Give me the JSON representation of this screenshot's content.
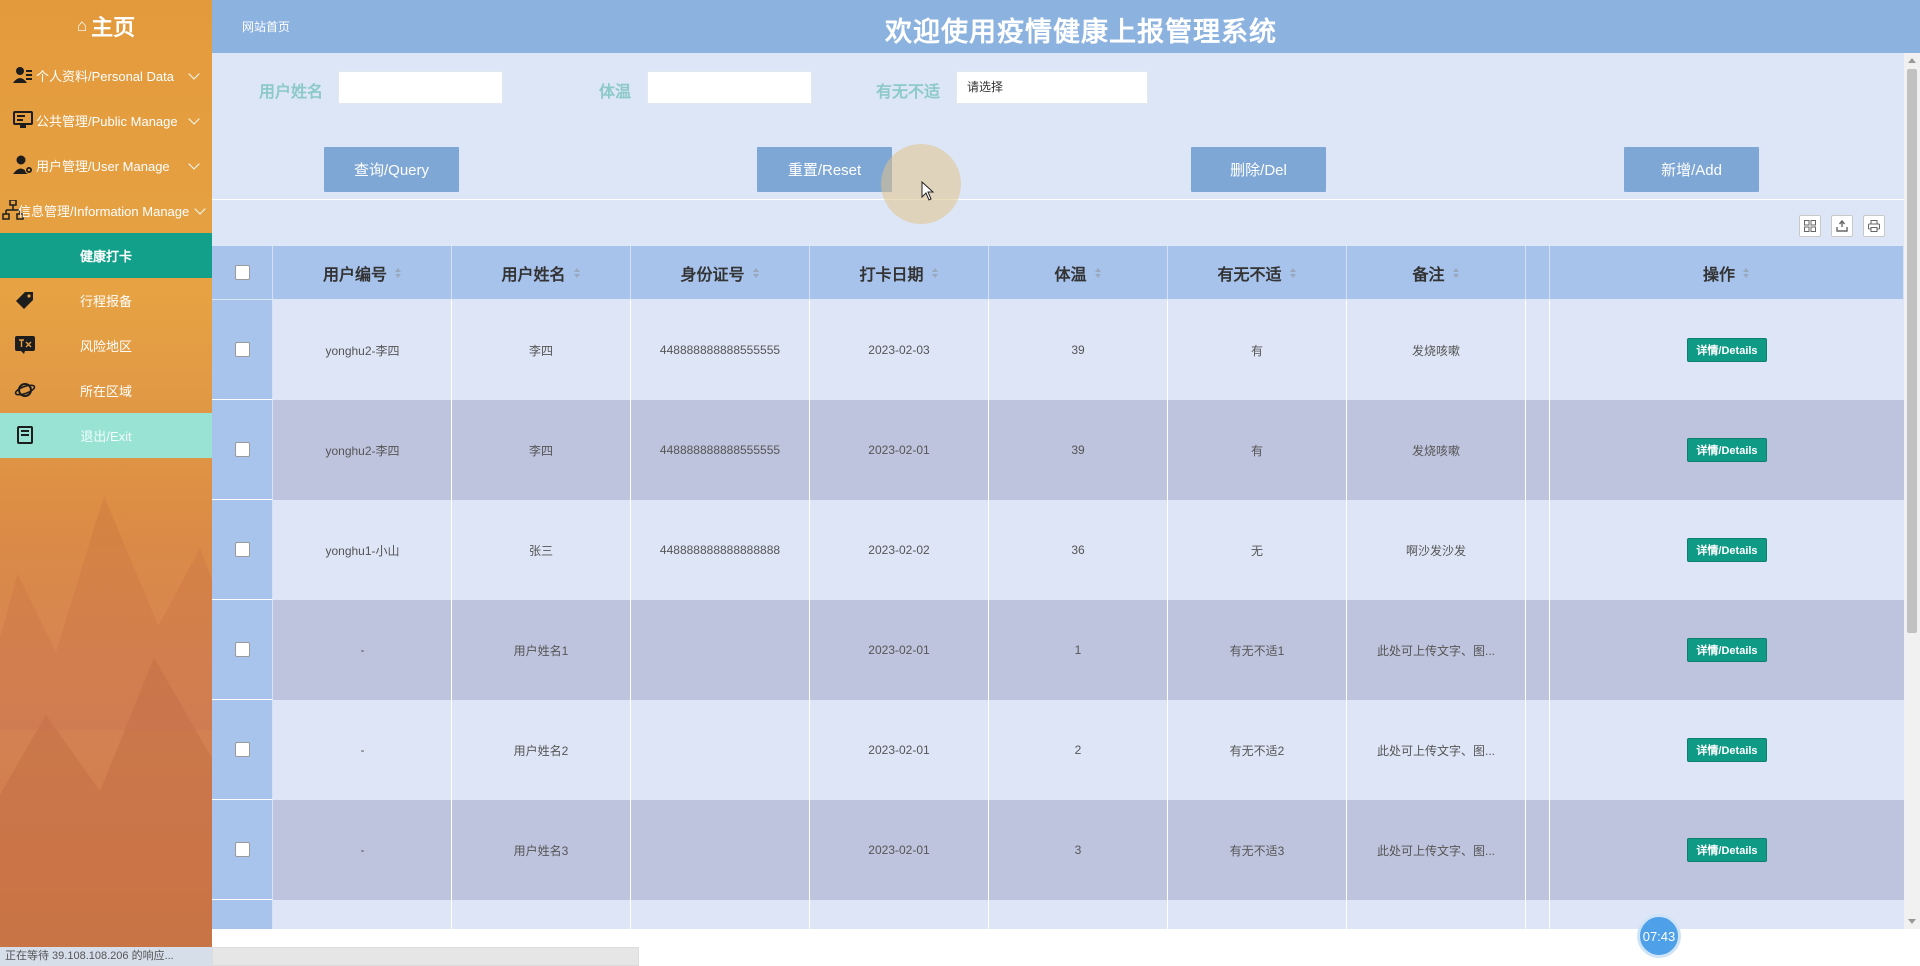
{
  "sidebar": {
    "brand": "主页",
    "items": [
      {
        "label": "个人资料/Personal Data",
        "icon": "user-card-icon",
        "expandable": true
      },
      {
        "label": "公共管理/Public Manage",
        "icon": "monitor-icon",
        "expandable": true
      },
      {
        "label": "用户管理/User Manage",
        "icon": "user-gear-icon",
        "expandable": true
      },
      {
        "label": "信息管理/Information Manage",
        "icon": "sitemap-icon",
        "expandable": true
      },
      {
        "label": "健康打卡",
        "active": true
      },
      {
        "label": "行程报备",
        "icon": "tag-icon"
      },
      {
        "label": "风险地区",
        "icon": "translate-icon"
      },
      {
        "label": "所在区域",
        "icon": "planet-icon"
      },
      {
        "label": "退出/Exit",
        "icon": "book-icon"
      }
    ],
    "status": "正在等待 39.108.108.206 的响应..."
  },
  "header": {
    "breadcrumb": "网站首页",
    "title": "欢迎使用疫情健康上报管理系统"
  },
  "search": {
    "name_label": "用户姓名",
    "name_value": "",
    "temp_label": "体温",
    "temp_value": "",
    "discomfort_label": "有无不适",
    "discomfort_placeholder": "请选择"
  },
  "buttons": {
    "query": "查询/Query",
    "reset": "重置/Reset",
    "delete": "删除/Del",
    "add": "新增/Add"
  },
  "table": {
    "headers": [
      "用户编号",
      "用户姓名",
      "身份证号",
      "打卡日期",
      "体温",
      "有无不适",
      "备注",
      "操作"
    ],
    "rows": [
      {
        "user_no": "yonghu2-李四",
        "name": "李四",
        "id_card": "448888888888555555",
        "date": "2023-02-03",
        "temp": "39",
        "discomfort": "有",
        "note": "发烧咳嗽",
        "action": "详情/Details"
      },
      {
        "user_no": "yonghu2-李四",
        "name": "李四",
        "id_card": "448888888888555555",
        "date": "2023-02-01",
        "temp": "39",
        "discomfort": "有",
        "note": "发烧咳嗽",
        "action": "详情/Details"
      },
      {
        "user_no": "yonghu1-小山",
        "name": "张三",
        "id_card": "448888888888888888",
        "date": "2023-02-02",
        "temp": "36",
        "discomfort": "无",
        "note": "啊沙发沙发",
        "action": "详情/Details"
      },
      {
        "user_no": "-",
        "name": "用户姓名1",
        "id_card": "",
        "date": "2023-02-01",
        "temp": "1",
        "discomfort": "有无不适1",
        "note": "此处可上传文字、图...",
        "action": "详情/Details"
      },
      {
        "user_no": "-",
        "name": "用户姓名2",
        "id_card": "",
        "date": "2023-02-01",
        "temp": "2",
        "discomfort": "有无不适2",
        "note": "此处可上传文字、图...",
        "action": "详情/Details"
      },
      {
        "user_no": "-",
        "name": "用户姓名3",
        "id_card": "",
        "date": "2023-02-01",
        "temp": "3",
        "discomfort": "有无不适3",
        "note": "此处可上传文字、图...",
        "action": "详情/Details"
      }
    ]
  },
  "clock": "07:43",
  "colors": {
    "sidebar_active": "#13a08a",
    "header": "#8cb2df",
    "button": "#7fa7d5",
    "details_button": "#0f9a86"
  }
}
